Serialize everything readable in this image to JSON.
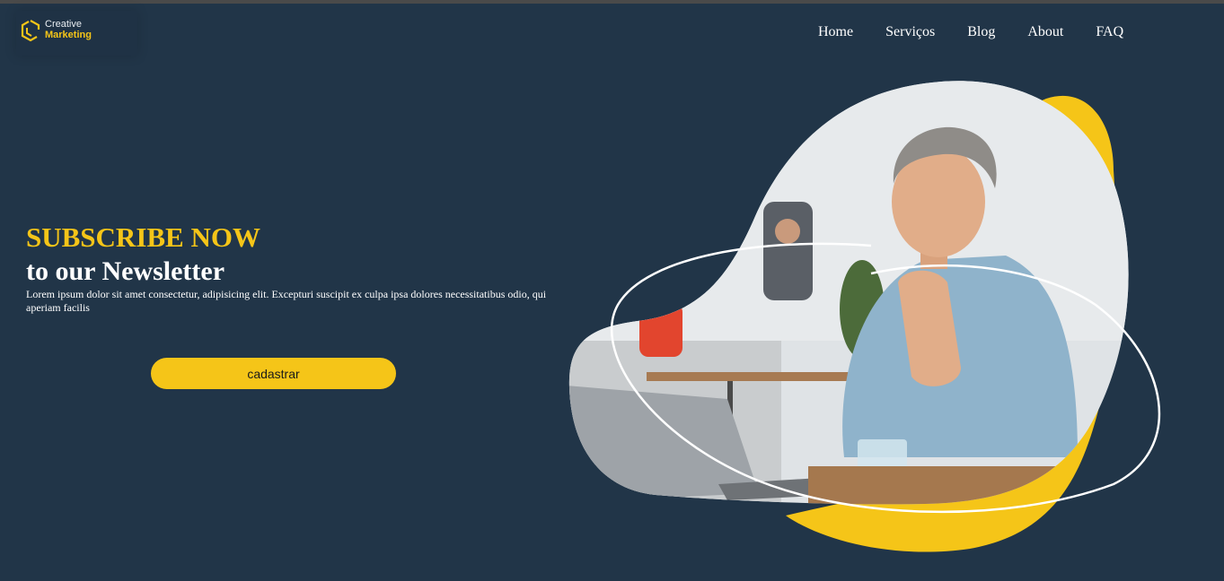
{
  "logo": {
    "line1": "Creative",
    "line2": "Marketing",
    "icon": "logo-hexagon-icon"
  },
  "nav": [
    {
      "label": "Home"
    },
    {
      "label": "Serviços"
    },
    {
      "label": "Blog"
    },
    {
      "label": "About"
    },
    {
      "label": "FAQ"
    }
  ],
  "hero": {
    "title": "SUBSCRIBE NOW",
    "subtitle": "to our Newsletter",
    "description": "Lorem ipsum dolor sit amet consectetur, adipisicing elit. Excepturi suscipit ex culpa ipsa dolores necessitatibus odio, qui aperiam facilis",
    "cta_label": "cadastrar"
  },
  "colors": {
    "background": "#213548",
    "accent": "#f5c518",
    "text": "#ffffff"
  }
}
